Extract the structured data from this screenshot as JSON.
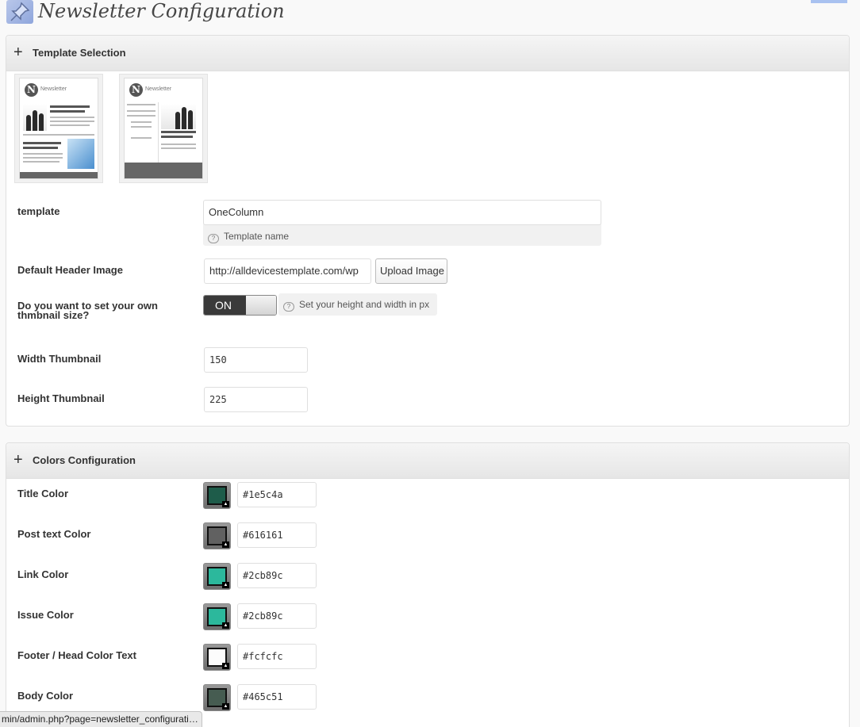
{
  "page": {
    "title": "Newsletter Configuration"
  },
  "template_panel": {
    "header": "Template Selection",
    "thumbnails": [
      {
        "label": "Newsletter"
      },
      {
        "label": "Newsletter"
      }
    ],
    "fields": {
      "template": {
        "label": "template",
        "value": "OneColumn",
        "help": "Template name"
      },
      "header_image": {
        "label": "Default Header Image",
        "value": "http://alldevicestemplate.com/wp",
        "button": "Upload Image"
      },
      "own_thumb": {
        "label_line1": "Do you want to set your own",
        "label_line2": "thmbnail size?",
        "toggle": "ON",
        "help": "Set your height and width in px"
      },
      "width": {
        "label": "Width Thumbnail",
        "value": "150"
      },
      "height": {
        "label": "Height Thumbnail",
        "value": "225"
      }
    }
  },
  "colors_panel": {
    "header": "Colors Configuration",
    "rows": [
      {
        "label": "Title Color",
        "value": "#1e5c4a",
        "color": "#1e5c4a"
      },
      {
        "label": "Post text Color",
        "value": "#616161",
        "color": "#616161"
      },
      {
        "label": "Link Color",
        "value": "#2cb89c",
        "color": "#2cb89c"
      },
      {
        "label": "Issue Color",
        "value": "#2cb89c",
        "color": "#2cb89c"
      },
      {
        "label": "Footer / Head Color Text",
        "value": "#fcfcfc",
        "color": "#fcfcfc"
      },
      {
        "label": "Body Color",
        "value": "#465c51",
        "color": "#465c51"
      }
    ]
  },
  "statusbar": {
    "url": "min/admin.php?page=newsletter_configurati…"
  }
}
